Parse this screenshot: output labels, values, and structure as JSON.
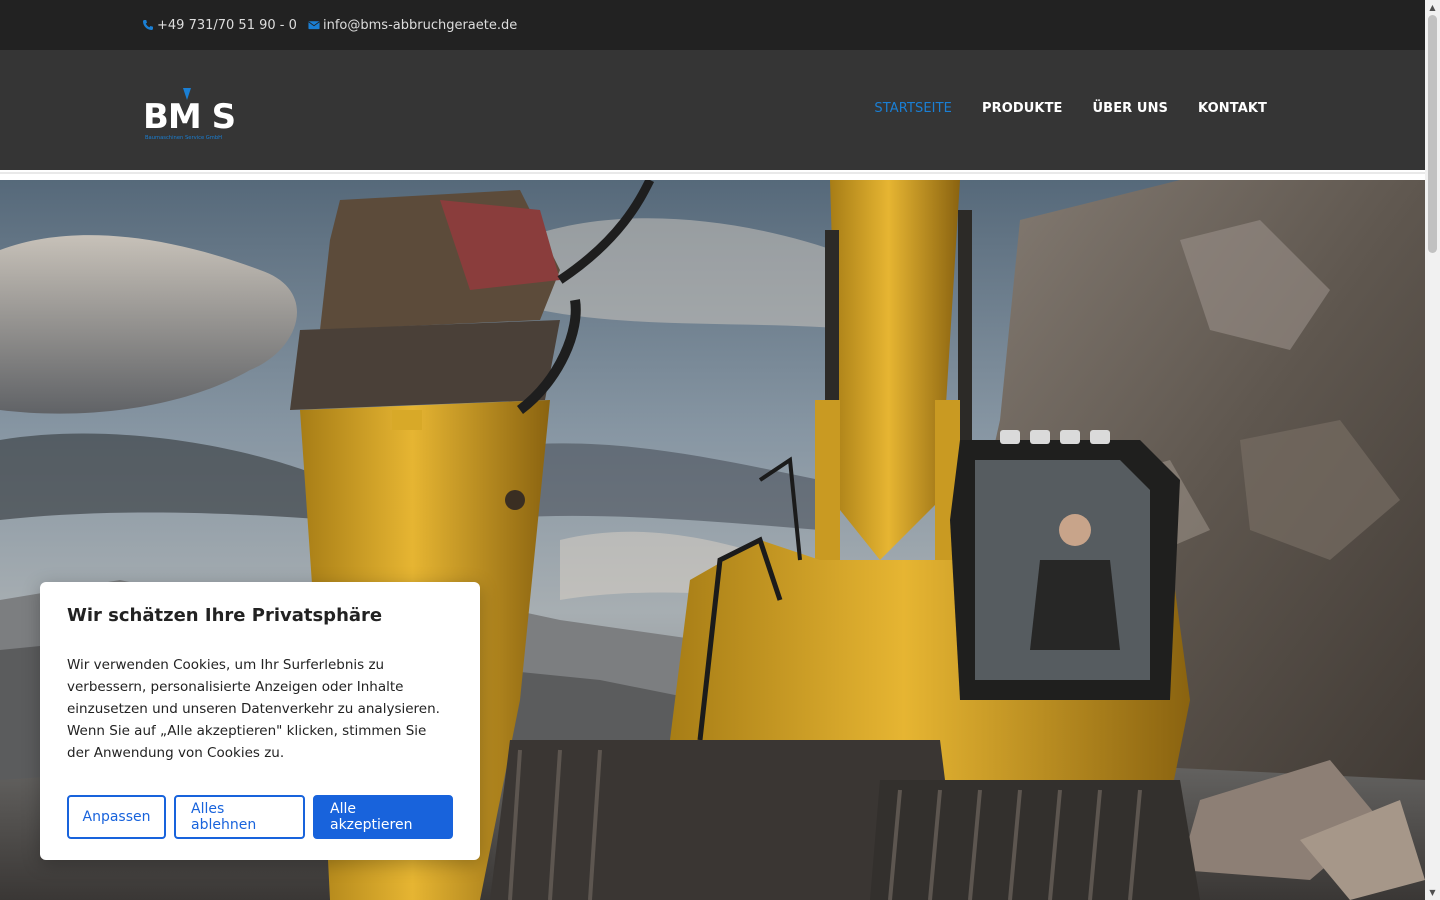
{
  "topbar": {
    "phone": "+49 731/70 51 90 - 0",
    "email": "info@bms-abbruchgeraete.de",
    "phone_icon": "phone-icon",
    "email_icon": "envelope-icon"
  },
  "header": {
    "logo_text": "BM S",
    "logo_subtitle": "Baumaschinen Service GmbH",
    "nav": [
      {
        "label": "STARTSEITE",
        "active": true
      },
      {
        "label": "PRODUKTE",
        "active": false
      },
      {
        "label": "ÜBER UNS",
        "active": false
      },
      {
        "label": "KONTAKT",
        "active": false
      }
    ]
  },
  "cookie": {
    "title": "Wir schätzen Ihre Privatsphäre",
    "text": "Wir verwenden Cookies, um Ihr Surferlebnis zu verbessern, personalisierte Anzeigen oder Inhalte einzusetzen und unseren Datenverkehr zu analysieren. Wenn Sie auf „Alle akzeptieren\" klicken, stimmen Sie der Anwendung von Cookies zu.",
    "customize_label": "Anpassen",
    "reject_label": "Alles ablehnen",
    "accept_label": "Alle akzeptieren"
  },
  "colors": {
    "topbar_bg": "#222222",
    "header_bg": "#353535",
    "accent": "#1a7fd4",
    "button_blue": "#1863dc"
  }
}
